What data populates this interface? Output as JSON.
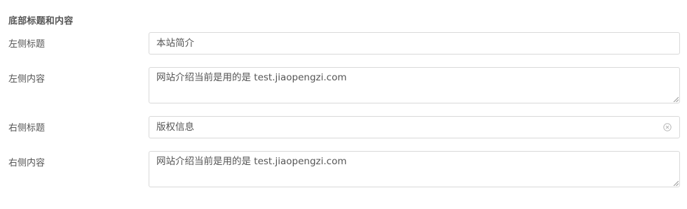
{
  "section": {
    "title": "底部标题和内容"
  },
  "left": {
    "title_label": "左侧标题",
    "title_value": "本站简介",
    "content_label": "左侧内容",
    "content_value": "网站介绍当前是用的是 test.jiaopengzi.com"
  },
  "right": {
    "title_label": "右侧标题",
    "title_value": "版权信息",
    "content_label": "右侧内容",
    "content_value": "网站介绍当前是用的是 test.jiaopengzi.com"
  },
  "icons": {
    "clear": "clear-circle-icon",
    "resize": "resize-grip-icon"
  }
}
